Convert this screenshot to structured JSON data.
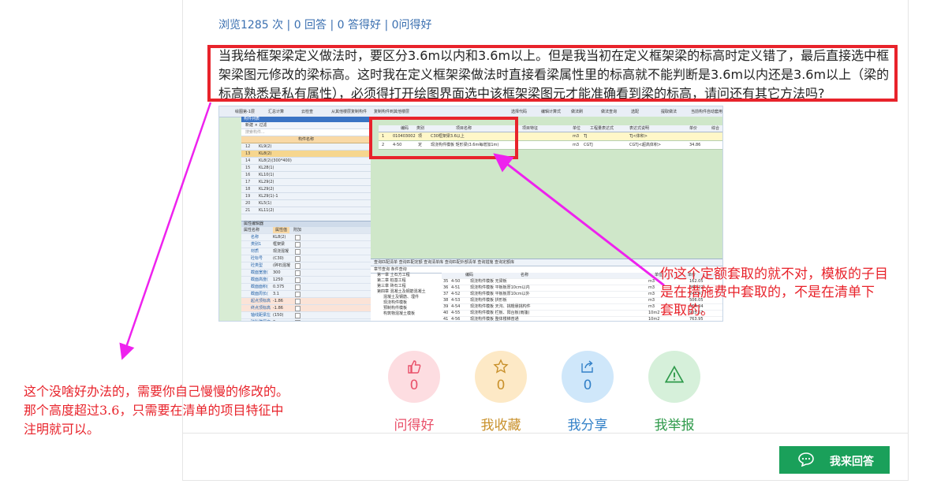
{
  "stats": {
    "text": "浏览1285 次 | 0 回答 | 0 答得好 | 0问得好"
  },
  "question": {
    "text": "当我给框架梁定义做法时，要区分3.6m以内和3.6m以上。但是我当初在定义框架梁的标高时定义错了，最后直接选中框架梁图元修改的梁标高。这时我在定义框架梁做法时直接看梁属性里的标高就不能判断是3.6m以内还是3.6m以上（梁的标高熟悉是私有属性），必须得打开绘图界面选中该框架梁图元才能准确看到梁的标高，请问还有其它方法吗?"
  },
  "screenshot": {
    "toolbar_items": [
      "绘图",
      "第-1层",
      "汇总计算",
      "云检查",
      "从其他楼层复制构件",
      "复制构件到其他楼层",
      "选择代码",
      "编辑计算式",
      "做法刷",
      "做法查询",
      "选配",
      "提取做法",
      "当前构件自动套用做法"
    ],
    "left_header": "构件列表",
    "left_tools": "新建 × 过滤",
    "left_search": "搜索构件...",
    "left_col": "构件名称",
    "left_rows": [
      {
        "n": "12",
        "v": "KL9(2)",
        "sel": false
      },
      {
        "n": "13",
        "v": "KL8(2)",
        "sel": true
      },
      {
        "n": "14",
        "v": "KL8(2)(300*400)",
        "sel": false
      },
      {
        "n": "15",
        "v": "KL28(1)",
        "sel": false
      },
      {
        "n": "16",
        "v": "KL10(1)",
        "sel": false
      },
      {
        "n": "17",
        "v": "KL29(2)",
        "sel": false
      },
      {
        "n": "18",
        "v": "KL29(2)",
        "sel": false
      },
      {
        "n": "19",
        "v": "KL29(1)-1",
        "sel": false
      },
      {
        "n": "20",
        "v": "KL5(1)",
        "sel": false
      },
      {
        "n": "21",
        "v": "KL11(2)",
        "sel": false
      }
    ],
    "prop_title": "属性编辑器",
    "prop_headers": [
      "属性名称",
      "属性值",
      "附加"
    ],
    "prop_rows": [
      {
        "k": "名称",
        "v": "KL8(2)"
      },
      {
        "k": "类别1",
        "v": "框架梁"
      },
      {
        "k": "材质",
        "v": "现浇混凝"
      },
      {
        "k": "砼标号",
        "v": "(C30)"
      },
      {
        "k": "砼类型",
        "v": "(碎石混凝"
      },
      {
        "k": "截面宽度(",
        "v": "300"
      },
      {
        "k": "截面高度(",
        "v": "1250"
      },
      {
        "k": "截面面积(",
        "v": "0.375"
      },
      {
        "k": "截面周长(",
        "v": "3.1"
      },
      {
        "k": "起点顶标高",
        "v": "-1.86"
      },
      {
        "k": "终点顶标高",
        "v": "-1.86"
      },
      {
        "k": "轴线距梁左",
        "v": "(150)"
      },
      {
        "k": "砖胎膜厚度",
        "v": "0"
      }
    ],
    "table_headers": [
      "编码",
      "类别",
      "项目名称",
      "项目特征",
      "单位",
      "工程量表达式",
      "表达式说明",
      "单价",
      "综合"
    ],
    "table_rows": [
      {
        "no": "1",
        "code": "010403002",
        "cat": "项",
        "name": "C30框架梁3.6以上",
        "unit": "m3",
        "expr": "TJ",
        "desc": "TJ<体积>",
        "price": ""
      },
      {
        "no": "2",
        "code": "4-50",
        "cat": "定",
        "name": "现浇构件模板 矩形梁(3.6m每增加1m)",
        "unit": "m3",
        "expr": "CGTJ",
        "desc": "CGTJ<超高体积>",
        "price": "34.86"
      }
    ],
    "bottom_tabs": "查询匹配清单  查询匹配定额  查询清单库  查询匹配外部清单  查询措施  查询定额库",
    "bottom_subtabs": "章节查询  条件查询",
    "bottom_tree": [
      "第一章 土石方工程",
      "第二章 桩基工程",
      "第三章 砖石工程",
      "第四章 混凝土及钢筋混凝土",
      "混凝土及钢筋、埋件",
      "现浇构件模板",
      "预制构件模板",
      "构筑物混凝土模板"
    ],
    "bottom_headers": [
      "编码",
      "名称",
      "单位",
      "单价"
    ],
    "bottom_rows": [
      {
        "no": "35",
        "code": "4-50",
        "name": "现浇构件模板 无梁板",
        "unit": "m3",
        "price": "162.05"
      },
      {
        "no": "36",
        "code": "4-51",
        "name": "现浇构件模板 平板板厚10cm以内",
        "unit": "m3",
        "price": "367.22"
      },
      {
        "no": "37",
        "code": "4-52",
        "name": "现浇构件模板 平板板厚10cm以外",
        "unit": "m3",
        "price": "248.47"
      },
      {
        "no": "38",
        "code": "4-53",
        "name": "现浇构件模板 拱形板",
        "unit": "m3",
        "price": "506.05"
      },
      {
        "no": "39",
        "code": "4-54",
        "name": "现浇构件模板 天沟、挑檐悬挑构件",
        "unit": "m3",
        "price": "664.04"
      },
      {
        "no": "40",
        "code": "4-55",
        "name": "现浇构件模板 栏板、阳台板(雨篷)",
        "unit": "10m2",
        "price": "905.57"
      },
      {
        "no": "41",
        "code": "4-56",
        "name": "现浇构件模板 整体楼梯普通",
        "unit": "10m2",
        "price": "763.95"
      }
    ]
  },
  "annotations": {
    "right": [
      "你这个定额套取的就不对，模板的子目",
      "是在措施费中套取的，不是在清单下",
      "套取的。"
    ],
    "left": [
      "这个没啥好办法的，需要你自己慢慢的修改的。",
      "那个高度超过3.6，只需要在清单的项目特征中",
      "注明就可以。"
    ]
  },
  "actions": [
    {
      "label": "问得好",
      "count": "0",
      "icon": "thumbs-up-icon",
      "bg": "#fddde1",
      "color": "#e9516a"
    },
    {
      "label": "我收藏",
      "count": "0",
      "icon": "star-icon",
      "bg": "#fde9c6",
      "color": "#c9912c"
    },
    {
      "label": "我分享",
      "count": "0",
      "icon": "share-icon",
      "bg": "#cfe7fa",
      "color": "#3381c8"
    },
    {
      "label": "我举报",
      "count": "",
      "icon": "warning-icon",
      "bg": "#d6f0da",
      "color": "#2f9a4b"
    }
  ],
  "answer_button": {
    "label": "我来回答"
  },
  "colors": {
    "annotation_red": "#e8232b",
    "arrow_magenta": "#ee22ee",
    "accent_green": "#1aa05a"
  }
}
